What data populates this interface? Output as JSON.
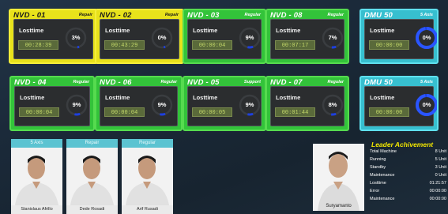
{
  "machines": [
    {
      "id": "nvd01",
      "title": "NVD - 01",
      "status": "Repair",
      "theme": "yellow",
      "label": "Losttime",
      "time": "00:28:39",
      "percent": "3%",
      "percent_value": 3
    },
    {
      "id": "nvd02",
      "title": "NVD - 02",
      "status": "Repair",
      "theme": "yellow",
      "label": "Losttime",
      "time": "00:43:29",
      "percent": "0%",
      "percent_value": 0
    },
    {
      "id": "nvd03",
      "title": "NVD - 03",
      "status": "Regular",
      "theme": "green",
      "label": "Losttime",
      "time": "00:00:04",
      "percent": "9%",
      "percent_value": 9
    },
    {
      "id": "nvd08",
      "title": "NVD - 08",
      "status": "Regular",
      "theme": "green",
      "label": "Losttime",
      "time": "00:07:17",
      "percent": "7%",
      "percent_value": 7
    },
    {
      "id": "dmu50a",
      "title": "DMU 50",
      "status": "5 Axis",
      "theme": "cyan",
      "label": "Losttime",
      "time": "00:00:00",
      "percent": "0%",
      "percent_value": 0
    },
    {
      "id": "nvd04",
      "title": "NVD - 04",
      "status": "Regular",
      "theme": "green",
      "label": "Losttime",
      "time": "00:00:04",
      "percent": "9%",
      "percent_value": 9
    },
    {
      "id": "nvd06",
      "title": "NVD - 06",
      "status": "Regular",
      "theme": "green",
      "label": "Losttime",
      "time": "00:00:04",
      "percent": "9%",
      "percent_value": 9
    },
    {
      "id": "nvd05",
      "title": "NVD - 05",
      "status": "Support",
      "theme": "green",
      "label": "Losttime",
      "time": "00:00:05",
      "percent": "9%",
      "percent_value": 9
    },
    {
      "id": "nvd07",
      "title": "NVD - 07",
      "status": "Regular",
      "theme": "green",
      "label": "Losttime",
      "time": "00:01:44",
      "percent": "8%",
      "percent_value": 8
    },
    {
      "id": "dmu50b",
      "title": "DMU 50",
      "status": "5 Axis",
      "theme": "cyan",
      "label": "Losttime",
      "time": "00:00:00",
      "percent": "0%",
      "percent_value": 0
    }
  ],
  "operators": [
    {
      "group": "5 Axis",
      "name": "Stanislaus Afrillo"
    },
    {
      "group": "Repair",
      "name": "Dede Rosadi"
    },
    {
      "group": "Regular",
      "name": "Arif Rusadi"
    }
  ],
  "leader": {
    "name": "Suryamanto",
    "title": "Leader Achivement",
    "stats": [
      {
        "k": "Total Machine",
        "v": "8 Unit"
      },
      {
        "k": "Running",
        "v": "5 Unit"
      },
      {
        "k": "Standby",
        "v": "3 Unit"
      },
      {
        "k": "Maintenance",
        "v": "0 Unit"
      },
      {
        "k": "Losttime",
        "v": "01:21:57"
      },
      {
        "k": "Error",
        "v": "00:00:00"
      },
      {
        "k": "Maintenance",
        "v": "00:00:00"
      }
    ]
  },
  "colors": {
    "yellow": "#e8e21b",
    "green": "#33c33a",
    "cyan": "#37bfcf",
    "ring_blue": "#1d3fe0",
    "accent_gold": "#f1e600"
  }
}
